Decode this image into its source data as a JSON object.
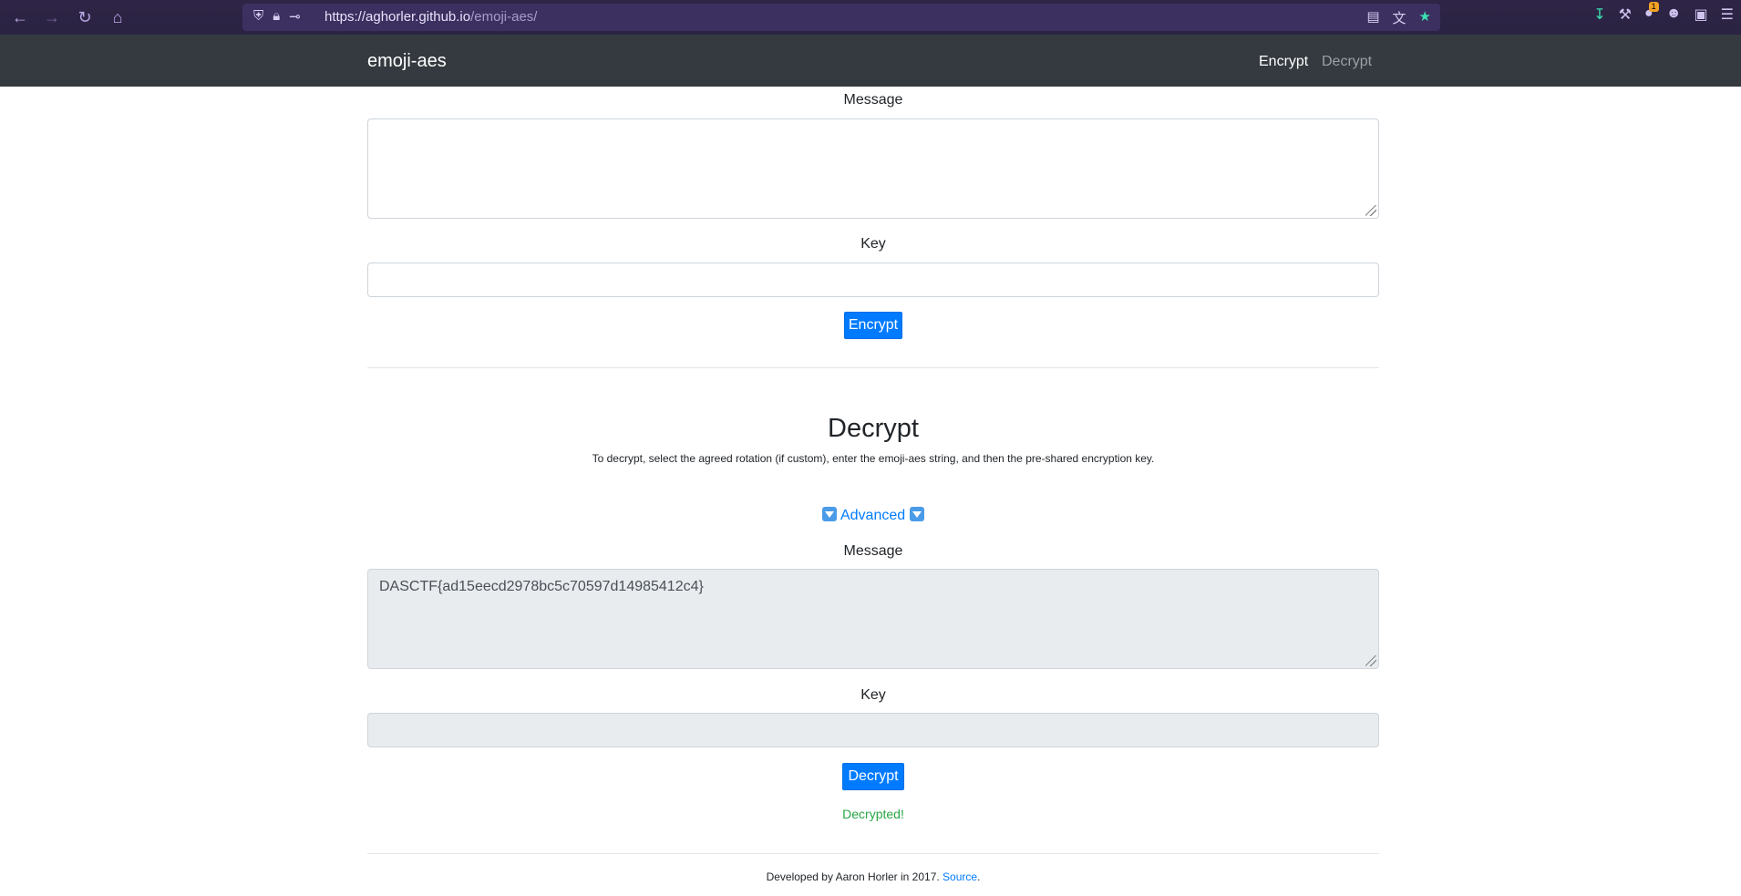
{
  "browser": {
    "url_host": "https://aghorler.github.io",
    "url_path": "/emoji-aes/",
    "extension_badge": "1"
  },
  "navbar": {
    "brand": "emoji-aes",
    "links": [
      {
        "label": "Encrypt",
        "active": true
      },
      {
        "label": "Decrypt",
        "active": false
      }
    ]
  },
  "encrypt": {
    "message_label": "Message",
    "message_value": "",
    "key_label": "Key",
    "key_value": "",
    "button_label": "Encrypt"
  },
  "decrypt": {
    "heading": "Decrypt",
    "help_text": "To decrypt, select the agreed rotation (if custom), enter the emoji-aes string, and then the pre-shared encryption key.",
    "advanced_label": "Advanced",
    "message_label": "Message",
    "message_value": "DASCTF{ad15eecd2978bc5c70597d14985412c4}",
    "key_label": "Key",
    "key_value": "",
    "button_label": "Decrypt",
    "status": "Decrypted!"
  },
  "footer": {
    "text": "Developed by Aaron Horler in 2017.",
    "link": "Source",
    "suffix": "."
  },
  "colors": {
    "primary": "#007bff",
    "navbar_bg": "#343a40",
    "success": "#28a745"
  }
}
